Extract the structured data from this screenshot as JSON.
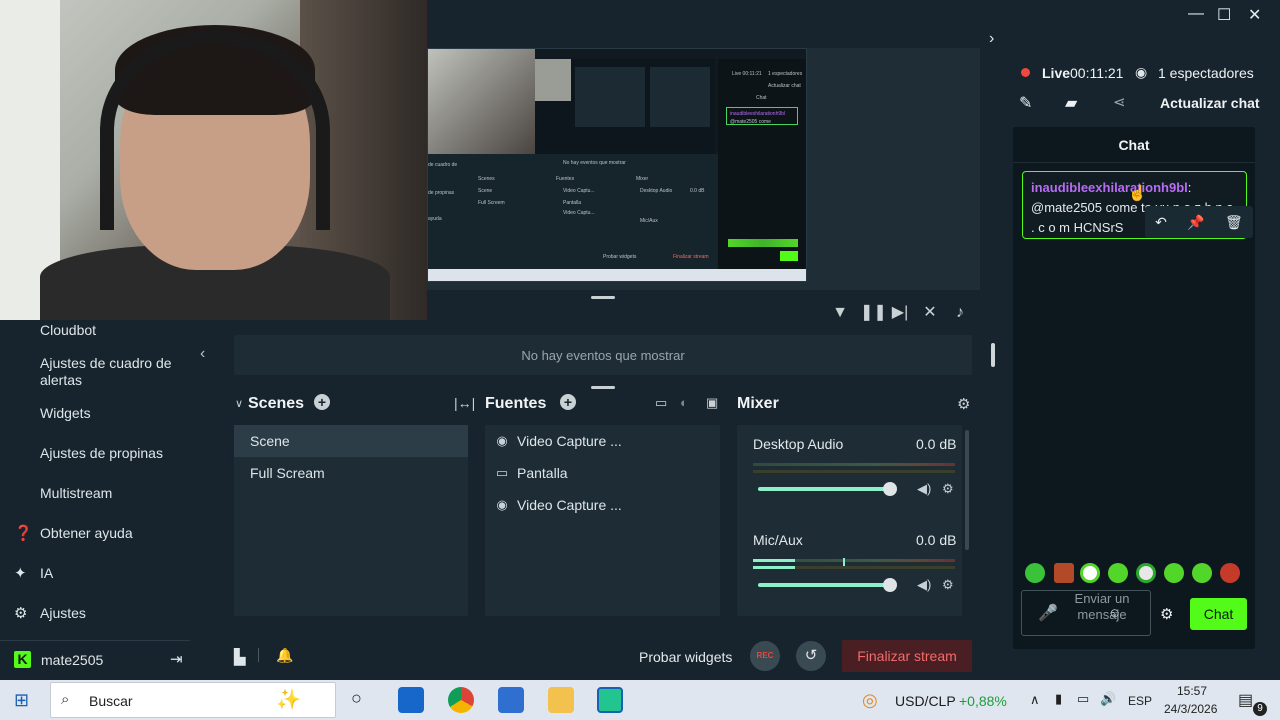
{
  "window": {
    "minimize": "—",
    "maximize": "☐",
    "close": "✕"
  },
  "preview": {
    "events_empty": "No hay eventos que mostrar",
    "thumb_live": "Live 00:11:21",
    "thumb_viewers": "1 espectadores",
    "thumb_update": "Actualizar chat",
    "thumb_chat": "Chat",
    "thumb_events": "No hay eventos que mostrar",
    "thumb_scenes": "Scenes",
    "thumb_sources": "Fuentes",
    "thumb_mixer": "Mixer",
    "thumb_scene": "Scene",
    "thumb_fullscreen": "Full Screem",
    "thumb_src1": "Video Captu...",
    "thumb_src2": "Pantalla",
    "thumb_src3": "Video Captu...",
    "thumb_desktop": "Desktop Audio",
    "thumb_mic": "Mic/Aux",
    "thumb_db": "0.0 dB",
    "thumb_probar": "Probar widgets",
    "thumb_end": "Finalizar stream",
    "thumb_sidebar_prop": "de propinas",
    "thumb_sidebar_cuadro": "de cuadro de",
    "thumb_sidebar_ayuda": "ayuda",
    "thumb_chat_user": "inaudibleexhilarationh9bl",
    "thumb_chat_msg": "@mate2505 come"
  },
  "sidebar": {
    "items": [
      {
        "label": "Cloudbot"
      },
      {
        "label": "Ajustes de cuadro de alertas"
      },
      {
        "label": "Widgets"
      },
      {
        "label": "Ajustes de propinas"
      },
      {
        "label": "Multistream"
      },
      {
        "label": "Obtener ayuda",
        "icon": "help-icon"
      },
      {
        "label": "IA",
        "icon": "sparkle-icon"
      },
      {
        "label": "Ajustes",
        "icon": "gear-icon"
      }
    ],
    "user": "mate2505"
  },
  "scenes": {
    "title": "Scenes",
    "items": [
      {
        "label": "Scene",
        "active": true
      },
      {
        "label": "Full Scream",
        "active": false
      }
    ]
  },
  "sources": {
    "title": "Fuentes",
    "items": [
      {
        "label": "Video Capture ...",
        "icon": "webcam-icon"
      },
      {
        "label": "Pantalla",
        "icon": "monitor-icon"
      },
      {
        "label": "Video Capture ...",
        "icon": "webcam-icon"
      }
    ]
  },
  "mixer": {
    "title": "Mixer",
    "channels": [
      {
        "name": "Desktop Audio",
        "db": "0.0 dB",
        "volume": 0.9,
        "level": 0.0
      },
      {
        "name": "Mic/Aux",
        "db": "0.0 dB",
        "volume": 0.9,
        "level": 0.22
      }
    ]
  },
  "bottombar": {
    "test_widgets": "Probar widgets",
    "rec": "REC",
    "end_stream": "Finalizar stream"
  },
  "live": {
    "status": "Live",
    "time": "00:11:21",
    "viewers": "1 espectadores",
    "update_chat": "Actualizar chat"
  },
  "chat": {
    "header": "Chat",
    "message": {
      "user": "inaudibleexhilarationh9bl",
      "text": "@mate2505 come to vu n o z h n a . c o m HCNSrS"
    },
    "input_placeholder": "Enviar un mensaje",
    "send": "Chat"
  },
  "taskbar": {
    "search_placeholder": "Buscar",
    "ticker_symbol": "USD/CLP",
    "ticker_change": "+0,88%",
    "lang": "ESP",
    "time": "15:57",
    "date": "24/3/2026",
    "notifications": "9"
  },
  "colors": {
    "accent_green": "#53fc18",
    "live_red": "#f0483e",
    "chat_user": "#b86cf5",
    "end_stream_text": "#f36a6a",
    "ticker_positive": "#1e9e3a"
  }
}
